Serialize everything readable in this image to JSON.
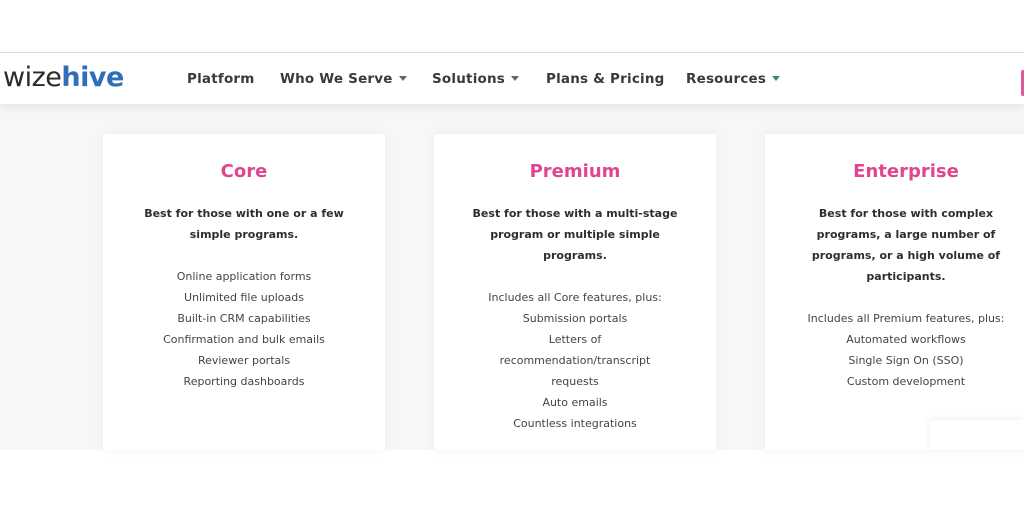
{
  "header": {
    "logo": {
      "part1": "wize",
      "part2": "hive"
    },
    "nav": [
      {
        "label": "Platform",
        "has_dropdown": false
      },
      {
        "label": "Who We Serve",
        "has_dropdown": true
      },
      {
        "label": "Solutions",
        "has_dropdown": true
      },
      {
        "label": "Plans & Pricing",
        "has_dropdown": false
      },
      {
        "label": "Resources",
        "has_dropdown": true
      }
    ]
  },
  "colors": {
    "brand_blue": "#2f6fba",
    "accent_pink": "#e0458f",
    "caret_teal": "#3a8a7d"
  },
  "plans": [
    {
      "name": "Core",
      "description": "Best for those with one or a few simple programs.",
      "features": [
        "Online application forms",
        "Unlimited file uploads",
        "Built-in CRM capabilities",
        "Confirmation and bulk emails",
        "Reviewer portals",
        "Reporting dashboards"
      ]
    },
    {
      "name": "Premium",
      "description": "Best for those with a multi-stage program or multiple simple programs.",
      "features": [
        "Includes all Core features, plus:",
        "Submission portals",
        "Letters of recommendation/transcript requests",
        "Auto emails",
        "Countless integrations"
      ]
    },
    {
      "name": "Enterprise",
      "description": "Best for those with complex programs, a large number of programs, or a high volume of participants.",
      "features": [
        "Includes all Premium features, plus:",
        "Automated workflows",
        "Single Sign On (SSO)",
        "Custom development"
      ]
    }
  ]
}
